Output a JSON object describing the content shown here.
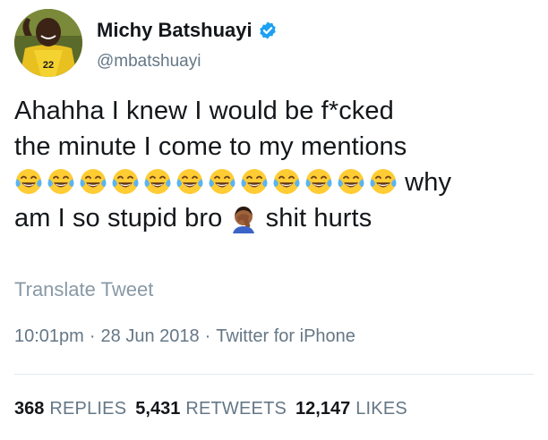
{
  "author": {
    "display_name": "Michy Batshuayi",
    "handle": "@mbatshuayi",
    "avatar_icon": "profile-avatar",
    "verified_icon": "verified-badge-icon"
  },
  "tweet": {
    "text_line1": "Ahahha I knew I would be f*cked",
    "text_line2": "the minute I come to my mentions",
    "text_after_emojis": "why",
    "text_line4a": "am I so stupid bro",
    "text_line4b": "shit hurts",
    "emoji_laughing_count": 12,
    "emoji_laughing_icon": "face-with-tears-of-joy-icon",
    "emoji_facepalm_icon": "person-facepalming-icon"
  },
  "translate_label": "Translate Tweet",
  "meta": {
    "time": "10:01pm",
    "separator": "·",
    "date": "28 Jun 2018",
    "source": "Twitter for iPhone"
  },
  "stats": {
    "replies_count": "368",
    "replies_label": "REPLIES",
    "retweets_count": "5,431",
    "retweets_label": "RETWEETS",
    "likes_count": "12,147",
    "likes_label": "LIKES"
  },
  "colors": {
    "primary_text": "#14171a",
    "secondary_text": "#657786",
    "muted_text": "#8899a6",
    "verified_blue": "#1da1f2",
    "divider": "#e1e8ed"
  }
}
